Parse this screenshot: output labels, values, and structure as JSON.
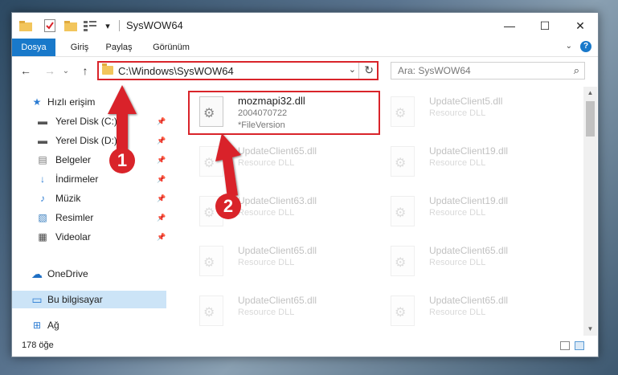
{
  "window": {
    "title": "SysWOW64",
    "controls": {
      "minimize": "—",
      "maximize": "☐",
      "close": "✕"
    }
  },
  "quick_access_toolbar": {
    "icons": [
      "folder-icon",
      "properties-icon",
      "new-folder-icon",
      "customize-icon"
    ],
    "dropdown": "▾"
  },
  "ribbon": {
    "tabs": [
      "Dosya",
      "Giriş",
      "Paylaş",
      "Görünüm"
    ],
    "help": "?",
    "collapse": "⌄"
  },
  "navigation": {
    "back": "←",
    "forward": "→",
    "recent": "⌄",
    "up": "↑",
    "address": "C:\\Windows\\SysWOW64",
    "address_dropdown": "⌄",
    "refresh": "↻",
    "search_placeholder": "Ara: SysWOW64",
    "search_icon": "⌕"
  },
  "sidebar": {
    "items": [
      {
        "label": "Hızlı erişim",
        "icon": "★",
        "pinned": false
      },
      {
        "label": "Yerel Disk (C:)",
        "icon": "▬",
        "pinned": true
      },
      {
        "label": "Yerel Disk (D:)",
        "icon": "▬",
        "pinned": true
      },
      {
        "label": "Belgeler",
        "icon": "▤",
        "pinned": true
      },
      {
        "label": "İndirmeler",
        "icon": "↓",
        "pinned": true
      },
      {
        "label": "Müzik",
        "icon": "♪",
        "pinned": true
      },
      {
        "label": "Resimler",
        "icon": "▧",
        "pinned": true
      },
      {
        "label": "Videolar",
        "icon": "▦",
        "pinned": true
      },
      {
        "label": "OneDrive",
        "icon": "☁",
        "pinned": false
      },
      {
        "label": "Bu bilgisayar",
        "icon": "▭",
        "pinned": false,
        "selected": true
      },
      {
        "label": "Ağ",
        "icon": "⊞",
        "pinned": false
      }
    ],
    "pin_glyph": "📌"
  },
  "files": {
    "highlighted": {
      "name": "mozmapi32.dll",
      "version": "2004070722",
      "description": "*FileVersion"
    },
    "left_column": [
      {
        "name": "UpdateClient65.dll",
        "description": "Resource DLL"
      },
      {
        "name": "UpdateClient63.dll",
        "description": "Resource DLL"
      },
      {
        "name": "UpdateClient65.dll",
        "description": "Resource DLL"
      },
      {
        "name": "UpdateClient65.dll",
        "description": "Resource DLL"
      }
    ],
    "right_column": [
      {
        "name": "UpdateClient5.dll",
        "description": "Resource DLL"
      },
      {
        "name": "UpdateClient19.dll",
        "description": "Resource DLL"
      },
      {
        "name": "UpdateClient19.dll",
        "description": "Resource DLL"
      },
      {
        "name": "UpdateClient65.dll",
        "description": "Resource DLL"
      },
      {
        "name": "UpdateClient65.dll",
        "description": "Resource DLL"
      }
    ]
  },
  "status": {
    "item_count": "178 öğe"
  },
  "annotations": {
    "step1": "1",
    "step2": "2",
    "color": "#d9242a"
  }
}
